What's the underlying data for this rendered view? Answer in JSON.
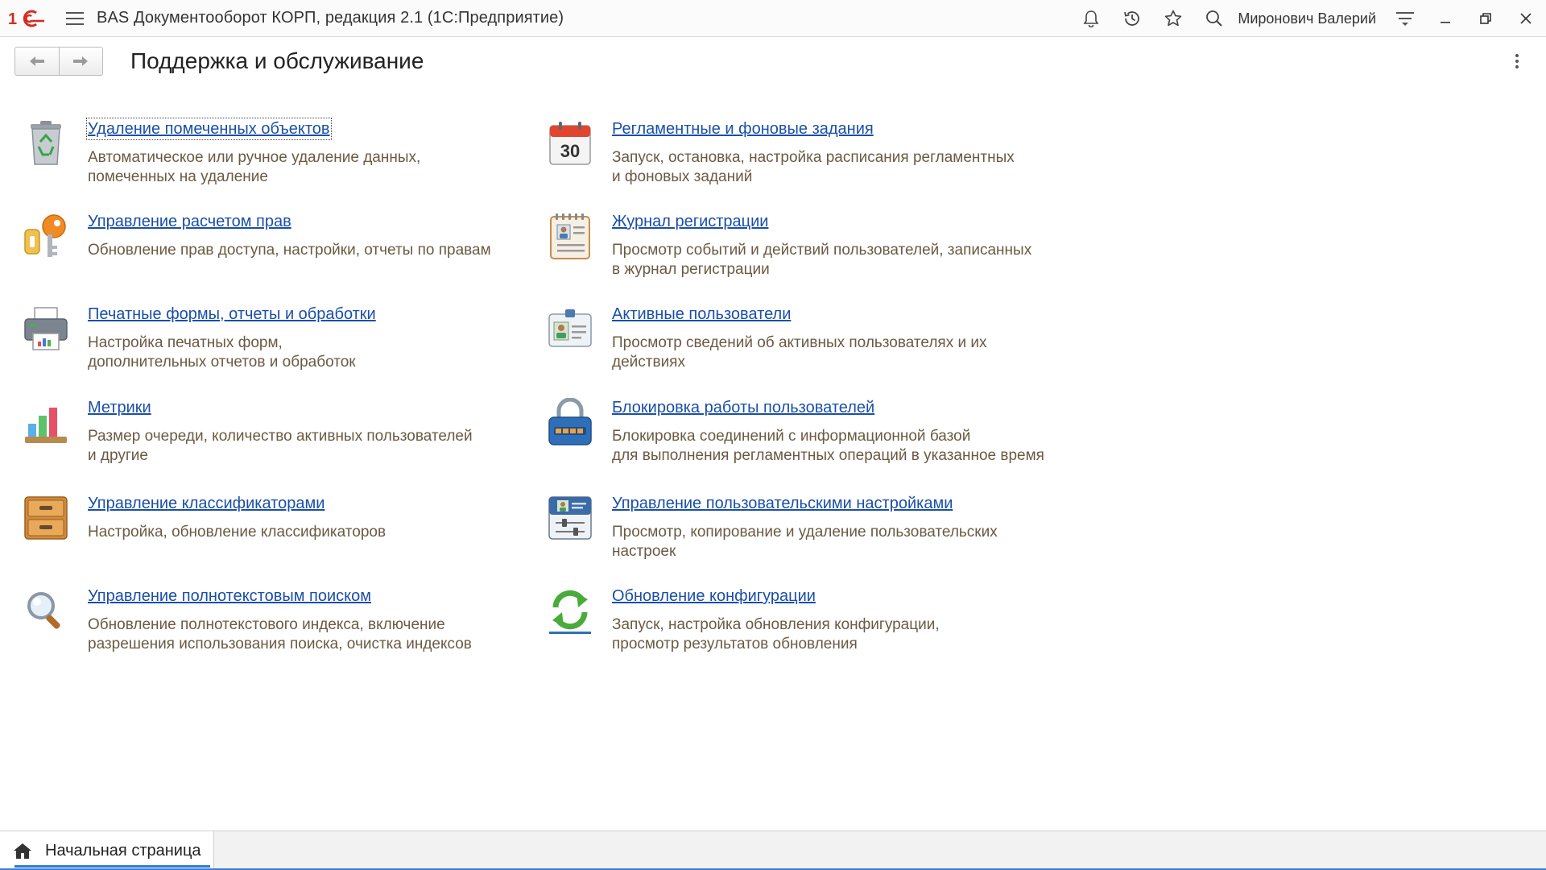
{
  "app": {
    "title": "BAS Документооборот КОРП, редакция 2.1  (1С:Предприятие)",
    "user": "Миронович Валерий",
    "brand_color": "#d52b1e",
    "link_color": "#1a4fa8",
    "desc_color": "#6b5a43"
  },
  "page": {
    "title": "Поддержка и обслуживание"
  },
  "items": [
    {
      "icon": "recycle-bin-icon",
      "title": "Удаление помеченных объектов",
      "desc": "Автоматическое или ручное удаление данных,\nпомеченных на удаление"
    },
    {
      "icon": "calendar-icon",
      "calendar_day": "30",
      "title": "Регламентные и фоновые задания",
      "desc": "Запуск, остановка, настройка расписания регламентных\nи фоновых заданий"
    },
    {
      "icon": "key-icon",
      "title": "Управление расчетом прав",
      "desc": "Обновление прав доступа, настройки, отчеты по правам"
    },
    {
      "icon": "journal-icon",
      "title": "Журнал регистрации",
      "desc": "Просмотр событий и действий пользователей, записанных\nв журнал регистрации"
    },
    {
      "icon": "printer-icon",
      "title": "Печатные формы, отчеты и обработки",
      "desc": "Настройка печатных форм,\nдополнительных отчетов и обработок"
    },
    {
      "icon": "id-card-icon",
      "title": "Активные пользователи",
      "desc": "Просмотр сведений об активных пользователях и их действиях"
    },
    {
      "icon": "bar-chart-icon",
      "title": "Метрики",
      "desc": "Размер очереди, количество активных пользователей\nи другие"
    },
    {
      "icon": "padlock-icon",
      "title": "Блокировка работы пользователей",
      "desc": "Блокировка соединений с информационной базой\nдля выполнения регламентных операций в указанное время"
    },
    {
      "icon": "file-cabinet-icon",
      "title": "Управление классификаторами",
      "desc": "Настройка, обновление классификаторов"
    },
    {
      "icon": "user-settings-icon",
      "title": "Управление пользовательскими настройками",
      "desc": "Просмотр, копирование и удаление пользовательских настроек"
    },
    {
      "icon": "magnifier-icon",
      "title": "Управление полнотекстовым поиском",
      "desc": "Обновление полнотекстового индекса, включение\nразрешения использования поиска, очистка индексов"
    },
    {
      "icon": "refresh-icon",
      "title": "Обновление конфигурации",
      "desc": "Запуск, настройка обновления конфигурации,\nпросмотр результатов обновления"
    }
  ],
  "bottom": {
    "home_tab": "Начальная страница"
  }
}
